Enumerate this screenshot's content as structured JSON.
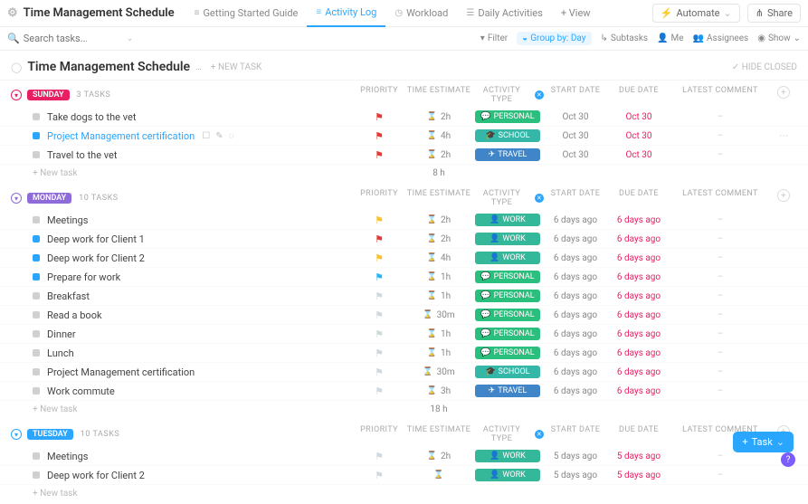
{
  "header": {
    "title": "Time Management Schedule",
    "tabs": [
      {
        "label": "Getting Started Guide",
        "icon": "≡"
      },
      {
        "label": "Activity Log",
        "icon": "≡",
        "active": true
      },
      {
        "label": "Workload",
        "icon": "◷"
      },
      {
        "label": "Daily Activities",
        "icon": "☰"
      }
    ],
    "add_view": "+ View",
    "automate": "Automate",
    "share": "Share"
  },
  "filter_bar": {
    "search_placeholder": "Search tasks...",
    "filter": "Filter",
    "group_by": "Group by: Day",
    "subtasks": "Subtasks",
    "me": "Me",
    "assignees": "Assignees",
    "show": "Show"
  },
  "list": {
    "title": "Time Management Schedule",
    "count": "…",
    "new_task": "+ NEW TASK",
    "hide_closed": "✓ HIDE CLOSED"
  },
  "columns": {
    "priority": "PRIORITY",
    "time": "TIME ESTIMATE",
    "activity": "ACTIVITY TYPE",
    "start": "START DATE",
    "due": "DUE DATE",
    "comment": "LATEST COMMENT"
  },
  "groups": [
    {
      "name": "SUNDAY",
      "color": "pink",
      "count": "3 TASKS",
      "sum": "8 h",
      "tasks": [
        {
          "name": "Take dogs to the vet",
          "status": "gray",
          "flag": "red",
          "time": "2h",
          "pill": "PERSONAL",
          "pillc": "p-personal",
          "pic": "💬",
          "start": "Oct 30",
          "due": "Oct 30"
        },
        {
          "name": "Project Management certification",
          "status": "blue",
          "flag": "red",
          "time": "4h",
          "pill": "SCHOOL",
          "pillc": "p-school",
          "pic": "🎓",
          "start": "Oct 30",
          "due": "Oct 30",
          "selected": true,
          "actions": true
        },
        {
          "name": "Travel to the vet",
          "status": "gray",
          "flag": "red",
          "time": "2h",
          "pill": "TRAVEL",
          "pillc": "p-travel",
          "pic": "✈",
          "start": "Oct 30",
          "due": "Oct 30"
        }
      ]
    },
    {
      "name": "MONDAY",
      "color": "purple",
      "count": "10 TASKS",
      "sum": "18 h",
      "tasks": [
        {
          "name": "Meetings",
          "status": "gray",
          "flag": "yellow",
          "time": "2h",
          "pill": "WORK",
          "pillc": "p-work",
          "pic": "👤",
          "start": "6 days ago",
          "due": "6 days ago"
        },
        {
          "name": "Deep work for Client 1",
          "status": "blue",
          "flag": "red",
          "time": "2h",
          "pill": "WORK",
          "pillc": "p-work",
          "pic": "👤",
          "start": "6 days ago",
          "due": "6 days ago"
        },
        {
          "name": "Deep work for Client 2",
          "status": "blue",
          "flag": "yellow",
          "time": "4h",
          "pill": "WORK",
          "pillc": "p-work",
          "pic": "👤",
          "start": "6 days ago",
          "due": "6 days ago"
        },
        {
          "name": "Prepare for work",
          "status": "blue",
          "flag": "blue",
          "time": "1h",
          "pill": "PERSONAL",
          "pillc": "p-personal",
          "pic": "💬",
          "start": "6 days ago",
          "due": "6 days ago"
        },
        {
          "name": "Breakfast",
          "status": "gray",
          "flag": "gray",
          "time": "1h",
          "pill": "PERSONAL",
          "pillc": "p-personal",
          "pic": "💬",
          "start": "6 days ago",
          "due": "6 days ago"
        },
        {
          "name": "Read a book",
          "status": "gray",
          "flag": "gray",
          "time": "30m",
          "pill": "PERSONAL",
          "pillc": "p-personal",
          "pic": "💬",
          "start": "6 days ago",
          "due": "6 days ago"
        },
        {
          "name": "Dinner",
          "status": "gray",
          "flag": "gray",
          "time": "1h",
          "pill": "PERSONAL",
          "pillc": "p-personal",
          "pic": "💬",
          "start": "6 days ago",
          "due": "6 days ago"
        },
        {
          "name": "Lunch",
          "status": "gray",
          "flag": "gray",
          "time": "1h",
          "pill": "PERSONAL",
          "pillc": "p-personal",
          "pic": "💬",
          "start": "6 days ago",
          "due": "6 days ago"
        },
        {
          "name": "Project Management certification",
          "status": "gray",
          "flag": "gray",
          "time": "30m",
          "pill": "SCHOOL",
          "pillc": "p-school",
          "pic": "🎓",
          "start": "6 days ago",
          "due": "6 days ago"
        },
        {
          "name": "Work commute",
          "status": "gray",
          "flag": "gray",
          "time": "3h",
          "pill": "TRAVEL",
          "pillc": "p-travel",
          "pic": "✈",
          "start": "6 days ago",
          "due": "6 days ago"
        }
      ]
    },
    {
      "name": "TUESDAY",
      "color": "blue",
      "count": "10 TASKS",
      "sum": "",
      "tasks": [
        {
          "name": "Meetings",
          "status": "gray",
          "flag": "gray",
          "time": "2h",
          "pill": "WORK",
          "pillc": "p-work",
          "pic": "👤",
          "start": "5 days ago",
          "due": "5 days ago"
        },
        {
          "name": "Deep work for Client 2",
          "status": "gray",
          "flag": "gray",
          "time": "",
          "pill": "WORK",
          "pillc": "p-work",
          "pic": "👤",
          "start": "5 days ago",
          "due": "5 days ago"
        }
      ]
    }
  ],
  "new_task_label": "+ New task",
  "fab": "Task"
}
